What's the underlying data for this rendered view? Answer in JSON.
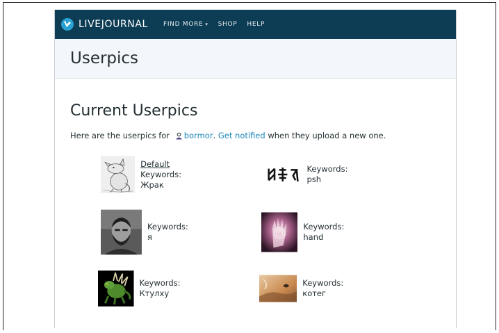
{
  "header": {
    "logo_text": "LIVEJOURNAL",
    "nav": [
      {
        "label": "FIND MORE",
        "caret": "▾"
      },
      {
        "label": "SHOP"
      },
      {
        "label": "HELP"
      }
    ]
  },
  "page_title": "Userpics",
  "main": {
    "heading": "Current Userpics",
    "intro_prefix": "Here are the userpics for ",
    "username": "bormor",
    "intro_mid": ". ",
    "notify_link": "Get notified",
    "intro_suffix": " when they upload a new one."
  },
  "userpics": [
    {
      "default_label": "Default",
      "keywords": "Keywords: Жрак",
      "icon": "cartoon-creature"
    },
    {
      "keywords": "Keywords: psh",
      "icon": "runes"
    },
    {
      "keywords": "Keywords: я",
      "icon": "bearded-man-portrait"
    },
    {
      "keywords": "Keywords: hand",
      "icon": "glowing-hand"
    },
    {
      "keywords": "Keywords: Ктулху",
      "icon": "green-monster"
    },
    {
      "keywords": "Keywords: котег",
      "icon": "cat-closeup"
    }
  ],
  "colors": {
    "topbar": "#0d3d55",
    "link": "#1a87b8",
    "title_bg": "#f3f6fa"
  }
}
